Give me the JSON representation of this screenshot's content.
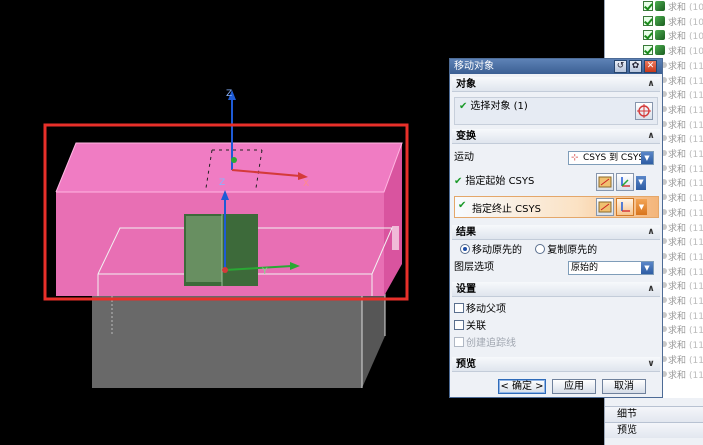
{
  "dialog": {
    "title": "移动对象",
    "sections": {
      "object": {
        "label": "对象",
        "select_object": "选择对象 (1)"
      },
      "transform": {
        "label": "变换",
        "motion_label": "运动",
        "motion_value": "CSYS 到 CSYS",
        "specify_start": "指定起始 CSYS",
        "specify_end": "指定终止 CSYS"
      },
      "result": {
        "label": "结果",
        "move_original": "移动原先的",
        "copy_original": "复制原先的",
        "layer_option_label": "图层选项",
        "layer_option_value": "原始的"
      },
      "settings": {
        "label": "设置",
        "move_parent": "移动父项",
        "associative": "关联",
        "create_trace": "创建追踪线"
      },
      "preview": {
        "label": "预览"
      }
    },
    "buttons": {
      "ok": "< 确定 >",
      "apply": "应用",
      "cancel": "取消"
    }
  },
  "navigator": {
    "rows": [
      {
        "text": "求和",
        "suffix": "(10"
      },
      {
        "text": "求和",
        "suffix": "(10"
      },
      {
        "text": "求和",
        "suffix": "(10"
      },
      {
        "text": "求和",
        "suffix": "(10"
      },
      {
        "text": "求和",
        "suffix": "(11"
      },
      {
        "text": "求和",
        "suffix": "(11"
      },
      {
        "text": "求和",
        "suffix": "(11"
      },
      {
        "text": "求和",
        "suffix": "(11"
      },
      {
        "text": "求和",
        "suffix": "(11"
      },
      {
        "text": "求和",
        "suffix": "(11"
      },
      {
        "text": "求和",
        "suffix": "(11"
      },
      {
        "text": "求和",
        "suffix": "(11"
      },
      {
        "text": "求和",
        "suffix": "(11"
      },
      {
        "text": "求和",
        "suffix": "(11"
      },
      {
        "text": "求和",
        "suffix": "(11"
      },
      {
        "text": "求和",
        "suffix": "(11"
      },
      {
        "text": "求和",
        "suffix": "(11"
      },
      {
        "text": "求和",
        "suffix": "(11"
      },
      {
        "text": "求和",
        "suffix": "(11"
      },
      {
        "text": "求和",
        "suffix": "(11"
      },
      {
        "text": "求和",
        "suffix": "(11"
      },
      {
        "text": "求和",
        "suffix": "(11"
      },
      {
        "text": "求和",
        "suffix": "(11"
      },
      {
        "text": "求和",
        "suffix": "(11"
      },
      {
        "text": "求和",
        "suffix": "(11"
      },
      {
        "text": "求和",
        "suffix": "(11"
      }
    ],
    "bottom": {
      "detail": "细节",
      "preview": "预览"
    }
  },
  "viewport": {
    "axis_labels": {
      "z_top": "Z",
      "x_right": "X",
      "z_mid": "Z",
      "y_label": "Y"
    }
  },
  "colors": {
    "accent": "#3b5f93",
    "annotation": "#e8302a",
    "block": "#e86fb4",
    "highlight": "#f4b57a"
  }
}
